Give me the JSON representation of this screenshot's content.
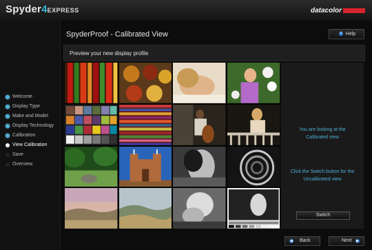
{
  "app": {
    "name_prefix": "Spyder",
    "name_number": "4",
    "name_suffix": "EXPRESS",
    "brand": "datacolor"
  },
  "page": {
    "title": "SpyderProof - Calibrated View",
    "subtitle": "Preview your new display profile"
  },
  "buttons": {
    "help": "Help",
    "switch": "Switch",
    "back": "Back",
    "next": "Next"
  },
  "nav": [
    {
      "label": "Welcome",
      "state": "done"
    },
    {
      "label": "Display Type",
      "state": "done"
    },
    {
      "label": "Make and Model",
      "state": "done"
    },
    {
      "label": "Display Technology",
      "state": "done"
    },
    {
      "label": "Calibration",
      "state": "done"
    },
    {
      "label": "View Calibration",
      "state": "current"
    },
    {
      "label": "Save",
      "state": "todo"
    },
    {
      "label": "Overview",
      "state": "todo"
    }
  ],
  "info": {
    "line1": "You are looking at the",
    "line2": "Calibrated view",
    "line3": "Click the Switch button for the",
    "line4": "Uncalibrated view"
  },
  "colors": {
    "accent": "#4fb0d8",
    "brand_red": "#d8242c",
    "background": "#0a0a0a"
  },
  "tiles": [
    "peppers",
    "bowls-of-spices",
    "woman-portrait",
    "girl-with-flowers",
    "color-checker",
    "fabric-stripes",
    "cellist",
    "woman-on-balcony",
    "garden",
    "adobe-church",
    "bw-portrait",
    "spiral-staircase",
    "sunset-hills",
    "rolling-landscape",
    "bw-statue",
    "bw-test-image"
  ]
}
